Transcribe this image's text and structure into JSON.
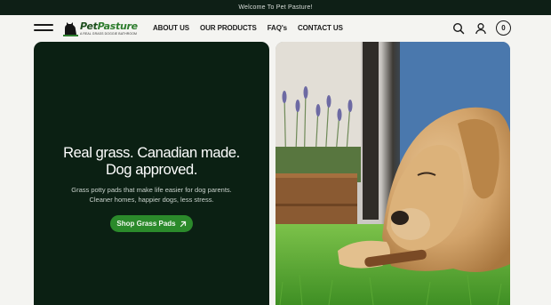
{
  "announcement": "Welcome To Pet Pasture!",
  "brand": {
    "name_part1": "Pet",
    "name_part2": "Pasture",
    "tagline": "A REAL GRASS DOGGIE BATHROOM"
  },
  "nav": {
    "items": [
      {
        "label": "ABOUT US"
      },
      {
        "label": "OUR PRODUCTS"
      },
      {
        "label": "FAQ's"
      },
      {
        "label": "CONTACT US"
      }
    ],
    "cart_count": "0"
  },
  "hero": {
    "headline_line1": "Real grass. Canadian made.",
    "headline_line2": "Dog approved.",
    "sub_line1": "Grass potty pads that make life easier for dog parents.",
    "sub_line2": "Cleaner homes, happier dogs, less stress.",
    "cta_label": "Shop Grass Pads"
  },
  "colors": {
    "announcement_bg": "#0e1f16",
    "hero_bg": "#0b2013",
    "accent": "#2b8a2b"
  },
  "icons": [
    "menu-icon",
    "search-icon",
    "account-icon",
    "cart-icon",
    "arrow-up-right-icon",
    "logo-dog-icon"
  ]
}
